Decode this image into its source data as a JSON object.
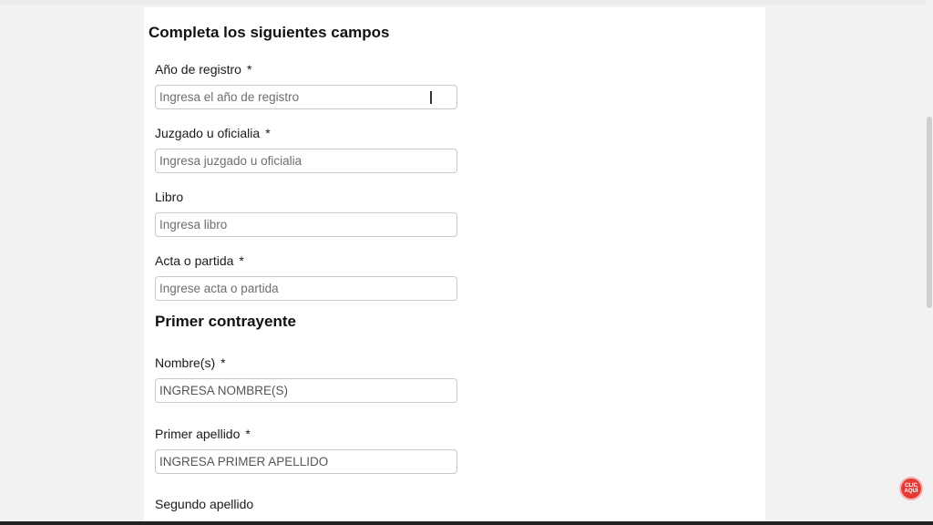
{
  "form": {
    "title": "Completa los siguientes campos",
    "fields": [
      {
        "label": "Año de registro",
        "required": "*",
        "placeholder": "Ingresa el año de registro"
      },
      {
        "label": "Juzgado u oficialia",
        "required": "*",
        "placeholder": "Ingresa juzgado u oficialia"
      },
      {
        "label": "Libro",
        "required": "",
        "placeholder": "Ingresa libro"
      },
      {
        "label": "Acta o partida",
        "required": "*",
        "placeholder": "Ingrese acta o partida"
      }
    ]
  },
  "primer_contrayente": {
    "title": "Primer contrayente",
    "fields": [
      {
        "label": "Nombre(s)",
        "required": "*",
        "placeholder": "INGRESA NOMBRE(S)"
      },
      {
        "label": "Primer apellido",
        "required": "*",
        "placeholder": "INGRESA PRIMER APELLIDO"
      },
      {
        "label": "Segundo apellido",
        "required": ""
      }
    ]
  },
  "badge": {
    "line1": "CLIC",
    "line2": "AQUÍ",
    "color": "#e53935"
  }
}
